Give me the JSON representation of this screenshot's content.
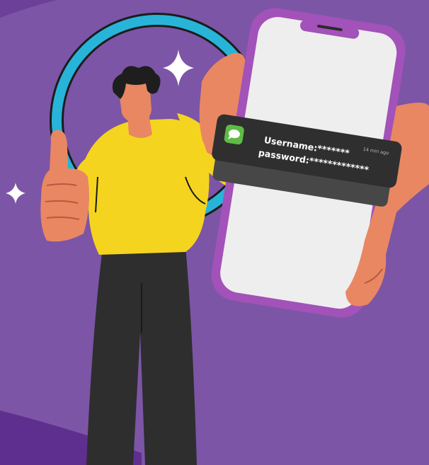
{
  "notification": {
    "username_text": "Username:*******",
    "password_text": "password:*************",
    "time_ago": "14 min ago"
  },
  "colors": {
    "background": "#7c55a6",
    "background_dark": "#5f2f8f",
    "ring": "#27b4d8",
    "shirt": "#f5d41f",
    "skin": "#e98763",
    "hair": "#1e1e1e",
    "pants": "#2e2e2e",
    "phone_frame": "#a252b8",
    "phone_screen": "#eeeeee",
    "notification_bg": "#2f2f2f",
    "message_icon": "#5fbb46"
  },
  "icons": [
    "sparkle-icon",
    "message-bubble-icon"
  ]
}
